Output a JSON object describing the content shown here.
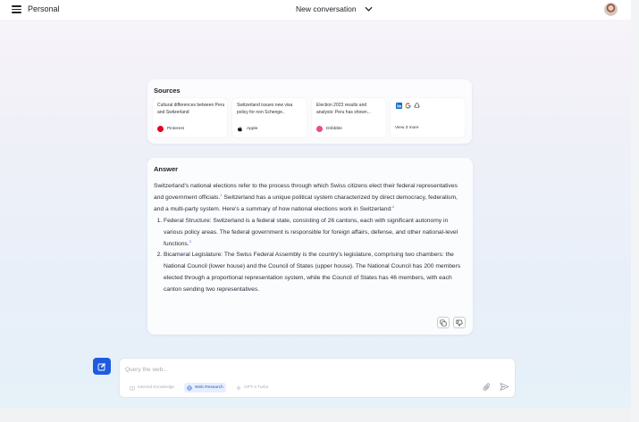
{
  "header": {
    "workspace_title": "Personal",
    "conversation_label": "New conversation"
  },
  "sources": {
    "heading": "Sources",
    "items": [
      {
        "title": "Cultural differences between Peru and Switzerland",
        "site": "Pinterest",
        "logo_color": "#e60023"
      },
      {
        "title": "Switzerland issues new visa policy for non Schenge..",
        "site": "Apple",
        "logo_color": "#111111"
      },
      {
        "title": "Election 2023 results and analysis: Peru has shown...",
        "site": "Dribbble",
        "logo_color": "#ea4c89"
      }
    ],
    "more_label": "View 3 more",
    "more_icons": [
      "linkedin-icon",
      "google-icon",
      "snapchat-icon"
    ]
  },
  "answer": {
    "heading": "Answer",
    "intro": "Switzerland's national elections refer to the process through which Swiss citizens elect their federal representatives and government officials.",
    "intro_ref": "1",
    "intro2": " Switzerland has a unique political system characterized by direct democracy, federalism, and a multi-party system. Here's a summary of how national elections work in Switzerland:",
    "intro2_ref": "2",
    "points": [
      {
        "text": "Federal Structure: Switzerland is a federal state, consisting of 26 cantons, each with significant autonomy in various policy areas. The federal government is responsible for foreign affairs, defense, and other national-level functions.",
        "ref": "3"
      },
      {
        "text": "Bicameral Legislature: The Swiss Federal Assembly is the country's legislature, comprising two chambers: the National Council (lower house) and the Council of States (upper house). The National Council has 200 members elected through a proportional representation system, while the Council of States has 46 members, with each canton sending two representatives.",
        "ref": ""
      }
    ]
  },
  "composer": {
    "placeholder": "Query the web...",
    "options": [
      "Internal Knowledge",
      "Web Research",
      "GPT-4 Turbo"
    ],
    "active_option": "Web Research"
  },
  "colors": {
    "accent": "#1f5be0",
    "active_chip_bg": "#e6efff"
  }
}
